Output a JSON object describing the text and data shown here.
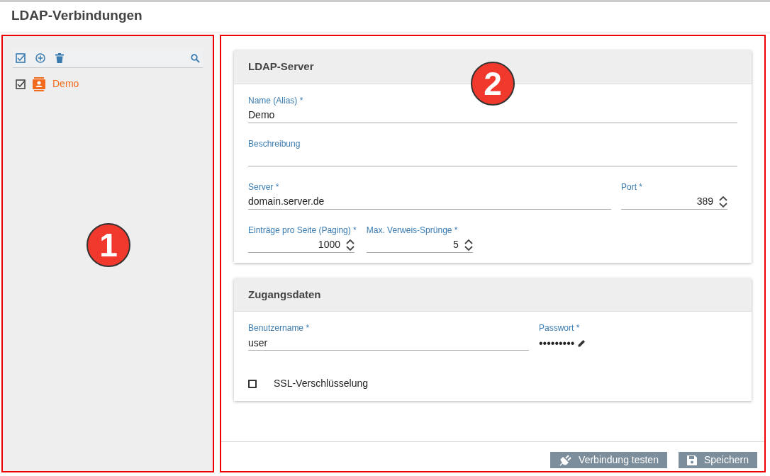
{
  "page_title": "LDAP-Verbindungen",
  "sidebar": {
    "callout": "1",
    "items": [
      {
        "label": "Demo",
        "checked": true
      }
    ]
  },
  "callouts": {
    "main": "2"
  },
  "cards": [
    {
      "title": "LDAP-Server",
      "rows": [
        [
          {
            "kind": "text",
            "label": "Name (Alias) *",
            "value": "Demo"
          }
        ],
        [
          {
            "kind": "text",
            "label": "Beschreibung"
          }
        ],
        [
          {
            "kind": "text",
            "label": "Server *",
            "value": "domain.server.de"
          },
          {
            "kind": "number",
            "label": "Port *",
            "value": "389"
          }
        ],
        [
          {
            "kind": "number",
            "label": "Einträge pro Seite (Paging) *",
            "value": "1000"
          },
          {
            "kind": "number",
            "label": "Max. Verweis-Sprünge *",
            "value": "5"
          }
        ]
      ]
    },
    {
      "title": "Zugangsdaten",
      "rows": [
        [
          {
            "kind": "text",
            "label": "Benutzername *",
            "value": "user"
          },
          {
            "kind": "password",
            "label": "Passwort *",
            "value": "•••••••••"
          }
        ],
        [
          {
            "kind": "checkbox",
            "label": "SSL-Verschlüsselung",
            "checked": false
          }
        ]
      ]
    }
  ],
  "buttons": [
    {
      "label": "Verbindung testen"
    },
    {
      "label": "Speichern"
    }
  ]
}
